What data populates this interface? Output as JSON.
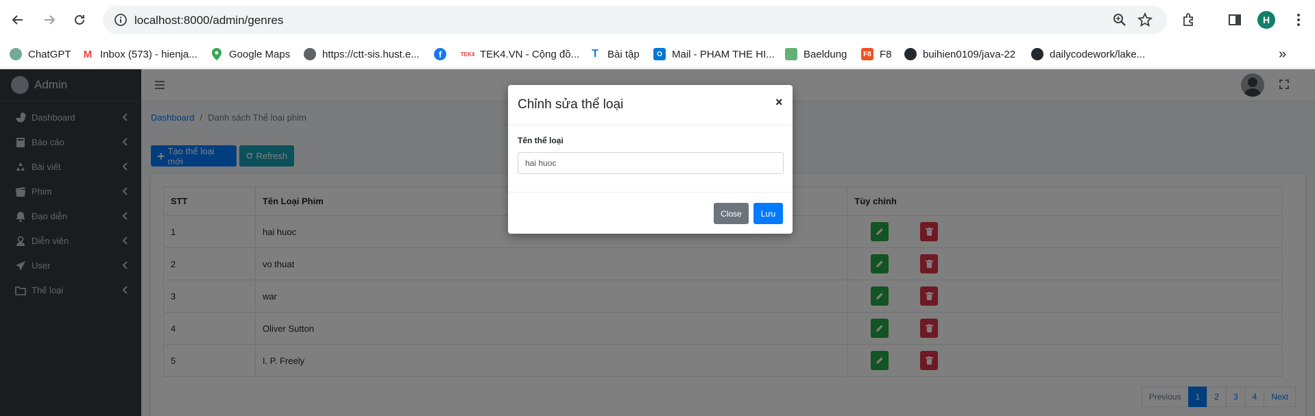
{
  "browser": {
    "url": "localhost:8000/admin/genres",
    "profile_initial": "H",
    "bookmarks": [
      {
        "label": "ChatGPT",
        "icon": "chatgpt-icon"
      },
      {
        "label": "Inbox (573) - hienja...",
        "icon": "gmail-icon"
      },
      {
        "label": "Google Maps",
        "icon": "google-maps-icon"
      },
      {
        "label": "https://ctt-sis.hust.e...",
        "icon": "globe-icon"
      },
      {
        "label": "",
        "icon": "facebook-icon"
      },
      {
        "label": "TEK4.VN - Cộng đồ...",
        "icon": "tek4-icon"
      },
      {
        "label": "Bài tập",
        "icon": "bai-tap-icon"
      },
      {
        "label": "Mail - PHAM THE HI...",
        "icon": "outlook-icon"
      },
      {
        "label": "Baeldung",
        "icon": "baeldung-icon"
      },
      {
        "label": "F8",
        "icon": "f8-icon"
      },
      {
        "label": "buihien0109/java-22",
        "icon": "github-icon"
      },
      {
        "label": "dailycodework/lake...",
        "icon": "github-icon"
      }
    ]
  },
  "sidebar": {
    "brand": "Admin",
    "items": [
      {
        "label": "Dashboard",
        "icon": "dashboard-icon"
      },
      {
        "label": "Báo cáo",
        "icon": "book-icon"
      },
      {
        "label": "Bài viết",
        "icon": "recycle-icon"
      },
      {
        "label": "Phim",
        "icon": "film-icon"
      },
      {
        "label": "Đạo diễn",
        "icon": "bell-icon"
      },
      {
        "label": "Diễn viên",
        "icon": "user-icon"
      },
      {
        "label": "User",
        "icon": "send-icon"
      },
      {
        "label": "Thể loại",
        "icon": "folder-icon"
      }
    ]
  },
  "breadcrumb": {
    "home": "Dashboard",
    "separator": "/",
    "current": "Danh sách Thể loại phim"
  },
  "actions": {
    "create_label": "Tạo thể loại mới",
    "refresh_label": "Refresh"
  },
  "table": {
    "headers": [
      "STT",
      "Tên Loại Phim",
      "Tùy chỉnh"
    ],
    "rows": [
      {
        "stt": "1",
        "name": "hai huoc"
      },
      {
        "stt": "2",
        "name": "vo thuat"
      },
      {
        "stt": "3",
        "name": "war"
      },
      {
        "stt": "4",
        "name": "Oliver Sutton"
      },
      {
        "stt": "5",
        "name": "I. P. Freely"
      }
    ]
  },
  "pagination": {
    "previous": "Previous",
    "pages": [
      "1",
      "2",
      "3",
      "4"
    ],
    "current": "1",
    "next": "Next"
  },
  "modal": {
    "title": "Chỉnh sửa thể loại",
    "close_x": "×",
    "field_label": "Tên thể loại",
    "field_value": "hai huoc",
    "close_label": "Close",
    "save_label": "Lưu"
  },
  "colors": {
    "primary": "#007bff",
    "info": "#17a2b8",
    "success": "#28a745",
    "danger": "#dc3545",
    "sidebar": "#343a40"
  }
}
